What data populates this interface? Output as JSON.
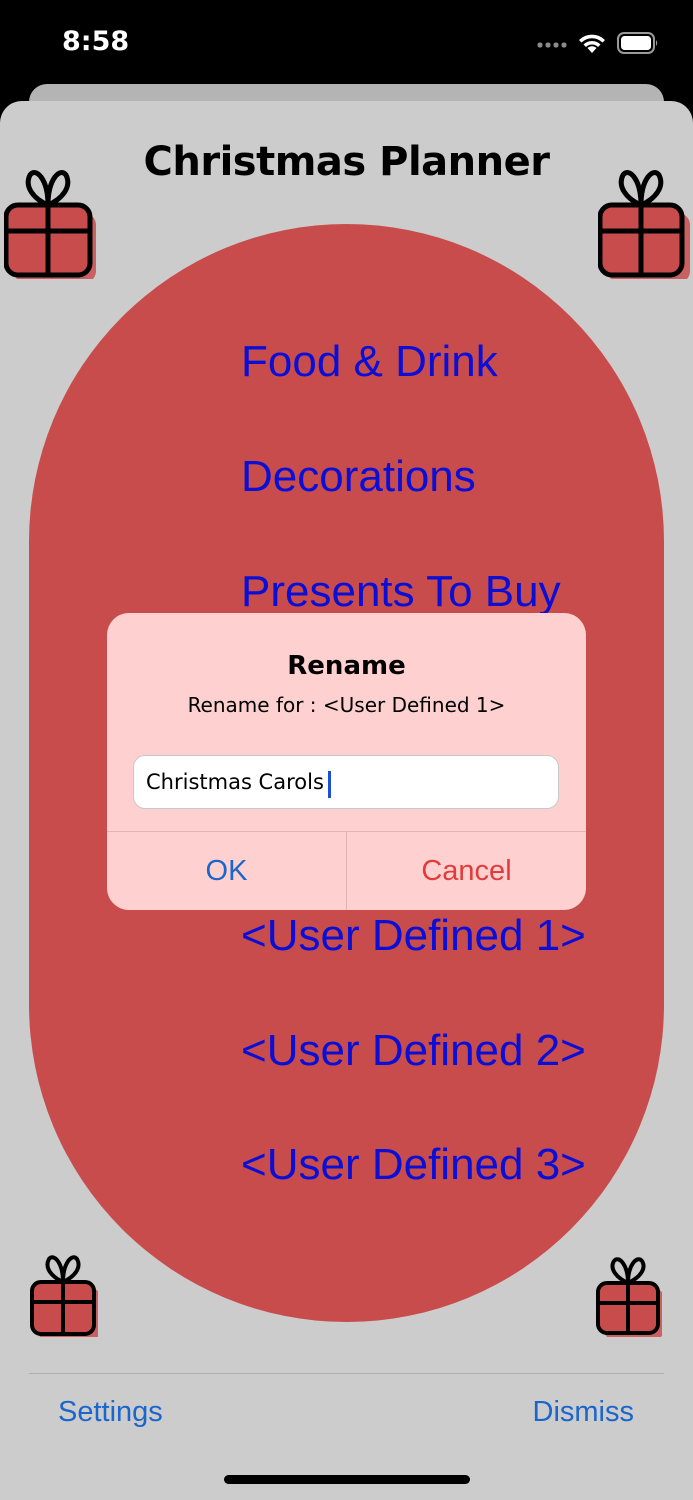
{
  "status_bar": {
    "time": "8:58",
    "signal_icon": "cellular-signal-icon",
    "wifi_icon": "wifi-icon",
    "battery_icon": "battery-icon"
  },
  "header": {
    "title": "Christmas Planner"
  },
  "menu": {
    "items": [
      {
        "label": "Food & Drink"
      },
      {
        "label": "Decorations"
      },
      {
        "label": "Presents To Buy"
      },
      {
        "label": "<User Defined 1>"
      },
      {
        "label": "<User Defined 2>"
      },
      {
        "label": "<User Defined 3>"
      }
    ]
  },
  "decorations": {
    "icon": "gift-icon",
    "gift_color": "#c94c4c"
  },
  "toolbar": {
    "settings_label": "Settings",
    "dismiss_label": "Dismiss"
  },
  "alert": {
    "title": "Rename",
    "message": "Rename for : <User Defined 1>",
    "input_value": "Christmas Carols",
    "ok_label": "OK",
    "cancel_label": "Cancel"
  },
  "colors": {
    "background": "#cccccc",
    "oval": "#c94c4c",
    "menu_text": "#0b0fd6",
    "toolbar_text": "#1a66cc",
    "alert_bg": "#ffd0d0",
    "cancel_text": "#e23b3b"
  }
}
